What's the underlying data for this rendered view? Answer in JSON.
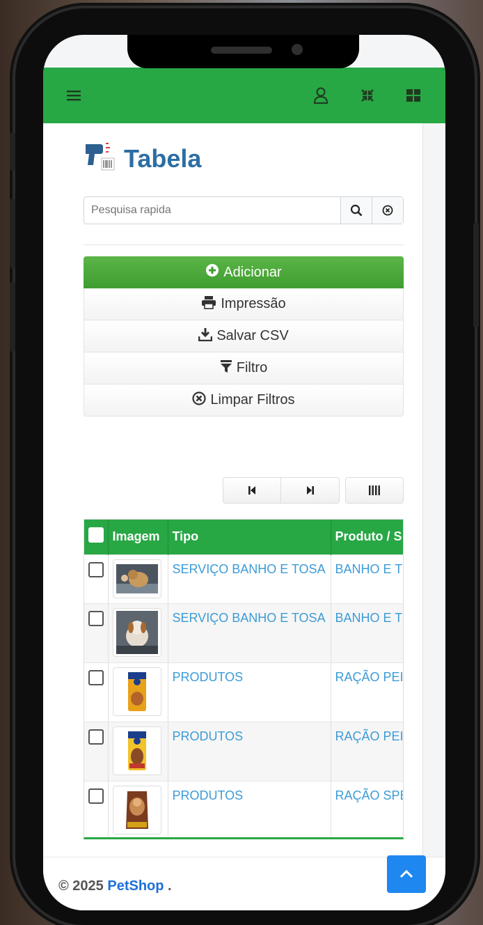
{
  "page": {
    "title": "Tabela"
  },
  "navbar": {
    "menu_icon": "hamburger-icon",
    "user_icon": "user-icon",
    "compress_icon": "compress-icon",
    "grid_icon": "grid-icon"
  },
  "search": {
    "placeholder": "Pesquisa rapida"
  },
  "actions": {
    "add": "Adicionar",
    "print": "Impressão",
    "csv": "Salvar CSV",
    "filter": "Filtro",
    "clear": "Limpar Filtros"
  },
  "table": {
    "headers": {
      "image": "Imagem",
      "type": "Tipo",
      "product": "Produto / S"
    },
    "rows": [
      {
        "type": "SERVIÇO BANHO E TOSA",
        "product": "BANHO E T",
        "image_icon": "dog-grooming-photo"
      },
      {
        "type": "SERVIÇO BANHO E TOSA",
        "product": "BANHO E T",
        "image_icon": "dog-grooming-photo"
      },
      {
        "type": "PRODUTOS",
        "product": "RAÇÃO PEI",
        "image_icon": "dog-food-bag"
      },
      {
        "type": "PRODUTOS",
        "product": "RAÇÃO PEI",
        "image_icon": "dog-food-bag"
      },
      {
        "type": "PRODUTOS",
        "product": "RAÇÃO SPE",
        "image_icon": "dog-food-bag"
      }
    ]
  },
  "footer": {
    "copyright": "© 2025",
    "brand": "PetShop",
    "suffix": "."
  },
  "colors": {
    "accent": "#28a745",
    "link": "#3d9bd6",
    "title": "#2d6ea3",
    "scroll_button": "#1e87f0"
  }
}
